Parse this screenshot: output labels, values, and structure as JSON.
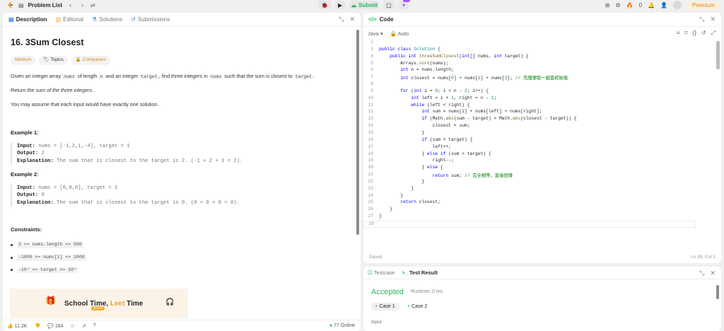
{
  "topbar": {
    "title": "Problem List",
    "submit_label": "Submit",
    "fire_count": "0",
    "premium_label": "Premium"
  },
  "left": {
    "tabs": [
      "Description",
      "Editorial",
      "Solutions",
      "Submissions"
    ],
    "title": "16. 3Sum Closest",
    "pills": [
      "Medium",
      "Topics",
      "Companies"
    ],
    "desc_pre": "Given an integer array ",
    "desc_nums": "nums",
    "desc_mid1": " of length ",
    "desc_n": "n",
    "desc_mid2": " and an integer ",
    "desc_target": "target",
    "desc_mid3": ", find three integers in ",
    "desc_nums2": "nums",
    "desc_mid4": " such that the sum is closest to ",
    "desc_target2": "target",
    "desc_end": ".",
    "return_pre": "Return ",
    "return_em": "the sum of the three integers",
    "return_end": ".",
    "assume": "You may assume that each input would have exactly one solution.",
    "examples": [
      {
        "title": "Example 1:",
        "input_label": "Input:",
        "input": "nums = [-1,2,1,-4], target = 1",
        "output_label": "Output:",
        "output": "2",
        "expl_label": "Explanation:",
        "expl": "The sum that is closest to the target is 2. (-1 + 2 + 1 = 2)."
      },
      {
        "title": "Example 2:",
        "input_label": "Input:",
        "input": "nums = [0,0,0], target = 1",
        "output_label": "Output:",
        "output": "0",
        "expl_label": "Explanation:",
        "expl": "The sum that is closest to the target is 0. (0 + 0 + 0 = 0)."
      }
    ],
    "constraints_title": "Constraints:",
    "constraints": [
      "3 <= nums.length <= 500",
      "-1000 <= nums[i] <= 1000",
      "-10⁴ <= target <= 10⁴"
    ],
    "banner_pre": "School Time, ",
    "banner_o": "Leet",
    "banner_post": " Time",
    "banner_price": "$119",
    "likes": "11.2K",
    "comments": "164",
    "online": "77 Online"
  },
  "code": {
    "header": "Code",
    "language": "Java",
    "auto": "Auto",
    "saved": "Saved",
    "position": "Ln 28, Col 1",
    "lines": [
      {
        "n": "2",
        "h": ""
      },
      {
        "n": "3",
        "h": "<span class='kw'>public class</span> <span class='ty'>Solution</span> {"
      },
      {
        "n": "4",
        "h": "    <span class='kw'>public int</span> <span class='fn'>threeSumClosest</span>(<span class='kw'>int</span>[] nums, <span class='kw'>int</span> target) {"
      },
      {
        "n": "5",
        "h": "        Arrays.<span class='fn'>sort</span>(nums);"
      },
      {
        "n": "6",
        "h": "        <span class='kw'>int</span> n = nums.length;"
      },
      {
        "n": "7",
        "h": "        <span class='kw'>int</span> closest = nums[<span class='nm'>0</span>] + nums[<span class='nm'>1</span>] + nums[<span class='nm'>2</span>]; <span class='cm'>// 先隨便取一組當初始值</span>"
      },
      {
        "n": "8",
        "h": ""
      },
      {
        "n": "9",
        "h": "        <span class='kw'>for</span> (<span class='kw'>int</span> i = <span class='nm'>0</span>; i &lt; n - <span class='nm'>2</span>; i++) {"
      },
      {
        "n": "10",
        "h": "            <span class='kw'>int</span> left = i + <span class='nm'>1</span>, right = n - <span class='nm'>1</span>;"
      },
      {
        "n": "11",
        "h": "            <span class='kw'>while</span> (left &lt; right) {"
      },
      {
        "n": "12",
        "h": "                <span class='kw'>int</span> sum = nums[i] + nums[left] + nums[right];"
      },
      {
        "n": "13",
        "h": "                <span class='kw'>if</span> (Math.<span class='fn'>abs</span>(sum - target) &lt; Math.<span class='fn'>abs</span>(closest - target)) {"
      },
      {
        "n": "14",
        "h": "                    closest = sum;"
      },
      {
        "n": "15",
        "h": "                }"
      },
      {
        "n": "16",
        "h": "                <span class='kw'>if</span> (sum &lt; target) {"
      },
      {
        "n": "17",
        "h": "                    left++;"
      },
      {
        "n": "18",
        "h": "                } <span class='kw'>else if</span> (sum &gt; target) {"
      },
      {
        "n": "19",
        "h": "                    right--;"
      },
      {
        "n": "20",
        "h": "                } <span class='kw'>else</span> {"
      },
      {
        "n": "21",
        "h": "                    <span class='kw'>return</span> sum; <span class='cm'>// 完全相等，直接回傳</span>"
      },
      {
        "n": "22",
        "h": "                }"
      },
      {
        "n": "23",
        "h": "            }"
      },
      {
        "n": "24",
        "h": "        }"
      },
      {
        "n": "25",
        "h": "        <span class='kw'>return</span> closest;"
      },
      {
        "n": "26",
        "h": "    }"
      },
      {
        "n": "27",
        "h": "}"
      },
      {
        "n": "28",
        "h": ""
      }
    ]
  },
  "test": {
    "tabs": [
      "Testcase",
      "Test Result"
    ],
    "status": "Accepted",
    "runtime": "Runtime: 0 ms",
    "cases": [
      "Case 1",
      "Case 2"
    ],
    "input_label": "Input"
  }
}
